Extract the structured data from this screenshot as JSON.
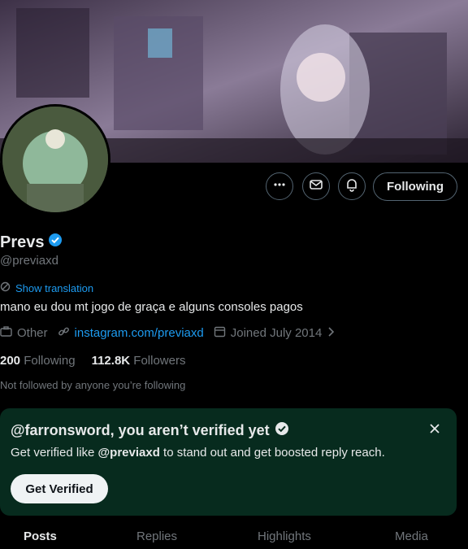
{
  "profile": {
    "name": "Prevs",
    "handle": "@previaxd",
    "show_translation": "Show translation",
    "bio": "mano eu dou mt jogo de graça e alguns consoles pagos",
    "category": "Other",
    "link": "instagram.com/previaxd",
    "joined": "Joined July 2014",
    "following_count": "200",
    "following_label": "Following",
    "followers_count": "112.8K",
    "followers_label": "Followers",
    "not_followed": "Not followed by anyone you’re following"
  },
  "actions": {
    "follow_label": "Following",
    "more_icon": "more-icon",
    "message_icon": "mail-icon",
    "notify_icon": "bell-icon"
  },
  "verify": {
    "title": "@farronsword, you aren’t verified yet",
    "text_prefix": "Get verified like ",
    "text_handle": "@previaxd",
    "text_suffix": " to stand out and get boosted reply reach.",
    "button": "Get Verified"
  },
  "tabs": [
    "Posts",
    "Replies",
    "Highlights",
    "Media"
  ],
  "colors": {
    "accent": "#1d9bf0",
    "verify_bg": "#072b1e",
    "text_muted": "#71767b"
  }
}
